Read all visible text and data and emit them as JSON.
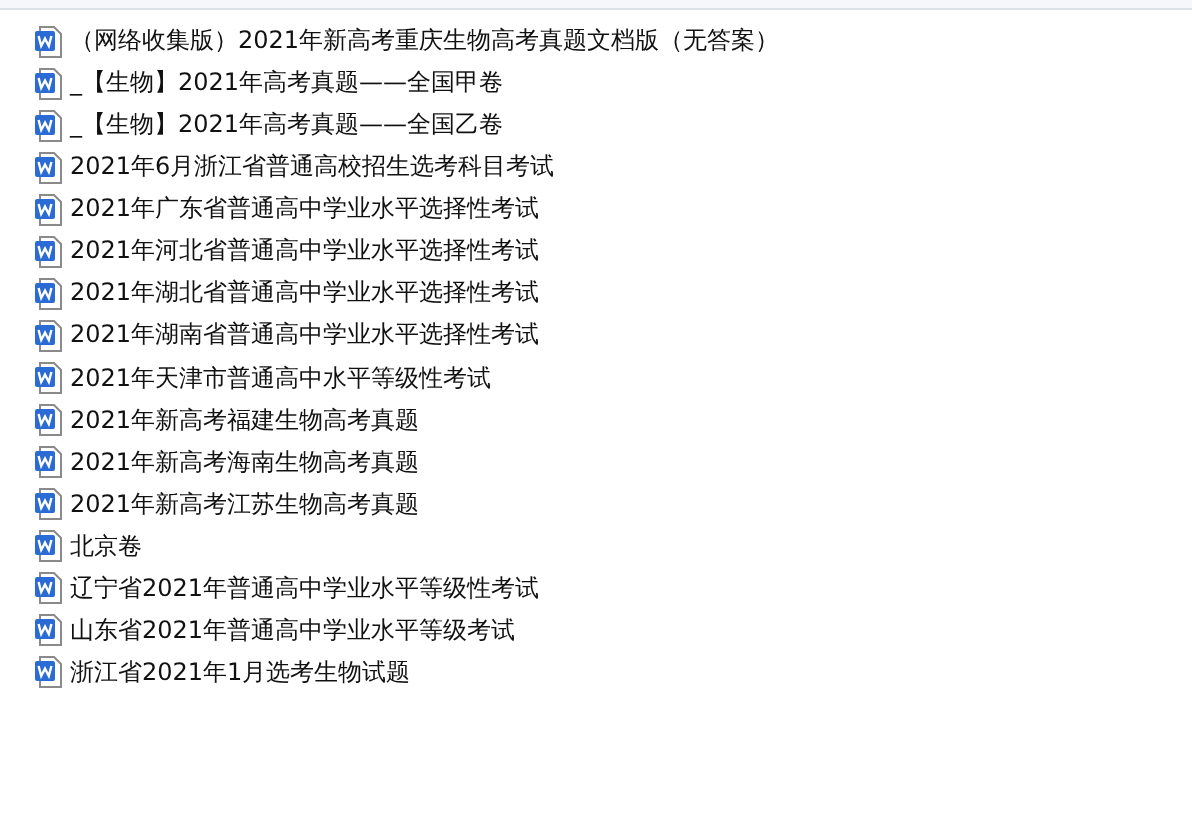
{
  "files": [
    {
      "name": "（网络收集版）2021年新高考重庆生物高考真题文档版（无答案）"
    },
    {
      "name": "_【生物】2021年高考真题——全国甲卷"
    },
    {
      "name": "_【生物】2021年高考真题——全国乙卷"
    },
    {
      "name": "2021年6月浙江省普通高校招生选考科目考试"
    },
    {
      "name": "2021年广东省普通高中学业水平选择性考试"
    },
    {
      "name": "2021年河北省普通高中学业水平选择性考试"
    },
    {
      "name": "2021年湖北省普通高中学业水平选择性考试"
    },
    {
      "name": "2021年湖南省普通高中学业水平选择性考试"
    },
    {
      "name": "2021年天津市普通高中水平等级性考试"
    },
    {
      "name": "2021年新高考福建生物高考真题"
    },
    {
      "name": "2021年新高考海南生物高考真题"
    },
    {
      "name": "2021年新高考江苏生物高考真题"
    },
    {
      "name": "北京卷"
    },
    {
      "name": "辽宁省2021年普通高中学业水平等级性考试"
    },
    {
      "name": "山东省2021年普通高中学业水平等级考试"
    },
    {
      "name": "浙江省2021年1月选考生物试题"
    }
  ]
}
